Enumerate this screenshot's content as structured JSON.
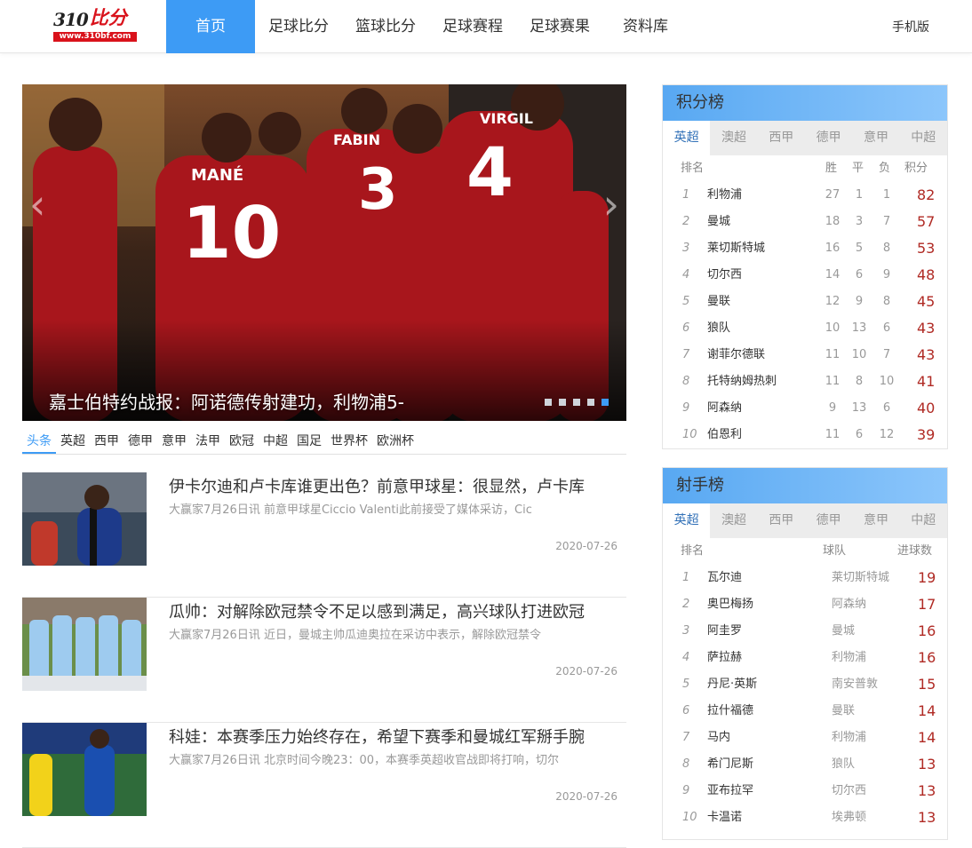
{
  "header": {
    "logo": {
      "text_num": "310",
      "text_cn": "比分",
      "url": "www.310bf.com"
    },
    "nav": [
      "首页",
      "足球比分",
      "篮球比分",
      "足球赛程",
      "足球赛果",
      "资料库"
    ],
    "mobile_label": "手机版"
  },
  "carousel": {
    "caption": "嘉士伯特约战报：阿诺德传射建功，利物浦5-",
    "slide_count": 5,
    "active_slide": 5
  },
  "news_tabs": [
    "头条",
    "英超",
    "西甲",
    "德甲",
    "意甲",
    "法甲",
    "欧冠",
    "中超",
    "国足",
    "世界杯",
    "欧洲杯"
  ],
  "news": [
    {
      "title": "伊卡尔迪和卢卡库谁更出色？前意甲球星：很显然，卢卡库",
      "summary": "大赢家7月26日讯 前意甲球星Ciccio Valenti此前接受了媒体采访，Cic",
      "date": "2020-07-26"
    },
    {
      "title": "瓜帅：对解除欧冠禁令不足以感到满足，高兴球队打进欧冠",
      "summary": "大赢家7月26日讯 近日，曼城主帅瓜迪奥拉在采访中表示，解除欧冠禁令",
      "date": "2020-07-26"
    },
    {
      "title": "科娃：本赛季压力始终存在，希望下赛季和曼城红军掰手腕",
      "summary": "大赢家7月26日讯 北京时间今晚23：00，本赛季英超收官战即将打响，切尔",
      "date": "2020-07-26"
    }
  ],
  "standings": {
    "title": "积分榜",
    "tabs": [
      "英超",
      "澳超",
      "西甲",
      "德甲",
      "意甲",
      "中超"
    ],
    "columns": {
      "rank": "排名",
      "w": "胜",
      "d": "平",
      "l": "负",
      "pts": "积分"
    },
    "rows": [
      {
        "rank": "1",
        "team": "利物浦",
        "w": "27",
        "d": "1",
        "l": "1",
        "pts": "82"
      },
      {
        "rank": "2",
        "team": "曼城",
        "w": "18",
        "d": "3",
        "l": "7",
        "pts": "57"
      },
      {
        "rank": "3",
        "team": "莱切斯特城",
        "w": "16",
        "d": "5",
        "l": "8",
        "pts": "53"
      },
      {
        "rank": "4",
        "team": "切尔西",
        "w": "14",
        "d": "6",
        "l": "9",
        "pts": "48"
      },
      {
        "rank": "5",
        "team": "曼联",
        "w": "12",
        "d": "9",
        "l": "8",
        "pts": "45"
      },
      {
        "rank": "6",
        "team": "狼队",
        "w": "10",
        "d": "13",
        "l": "6",
        "pts": "43"
      },
      {
        "rank": "7",
        "team": "谢菲尔德联",
        "w": "11",
        "d": "10",
        "l": "7",
        "pts": "43"
      },
      {
        "rank": "8",
        "team": "托特纳姆热刺",
        "w": "11",
        "d": "8",
        "l": "10",
        "pts": "41"
      },
      {
        "rank": "9",
        "team": "阿森纳",
        "w": "9",
        "d": "13",
        "l": "6",
        "pts": "40"
      },
      {
        "rank": "10",
        "team": "伯恩利",
        "w": "11",
        "d": "6",
        "l": "12",
        "pts": "39"
      }
    ]
  },
  "scorers": {
    "title": "射手榜",
    "tabs": [
      "英超",
      "澳超",
      "西甲",
      "德甲",
      "意甲",
      "中超"
    ],
    "columns": {
      "rank": "排名",
      "team": "球队",
      "goals": "进球数"
    },
    "rows": [
      {
        "rank": "1",
        "player": "瓦尔迪",
        "team": "莱切斯特城",
        "goals": "19"
      },
      {
        "rank": "2",
        "player": "奥巴梅扬",
        "team": "阿森纳",
        "goals": "17"
      },
      {
        "rank": "3",
        "player": "阿圭罗",
        "team": "曼城",
        "goals": "16"
      },
      {
        "rank": "4",
        "player": "萨拉赫",
        "team": "利物浦",
        "goals": "16"
      },
      {
        "rank": "5",
        "player": "丹尼·英斯",
        "team": "南安普敦",
        "goals": "15"
      },
      {
        "rank": "6",
        "player": "拉什福德",
        "team": "曼联",
        "goals": "14"
      },
      {
        "rank": "7",
        "player": "马内",
        "team": "利物浦",
        "goals": "14"
      },
      {
        "rank": "8",
        "player": "希门尼斯",
        "team": "狼队",
        "goals": "13"
      },
      {
        "rank": "9",
        "player": "亚布拉罕",
        "team": "切尔西",
        "goals": "13"
      },
      {
        "rank": "10",
        "player": "卡温诺",
        "team": "埃弗顿",
        "goals": "13"
      }
    ]
  },
  "colors": {
    "accent": "#3d9bf5",
    "points": "#b02a24",
    "brand": "#d9121b",
    "kit": "#b3191e"
  }
}
